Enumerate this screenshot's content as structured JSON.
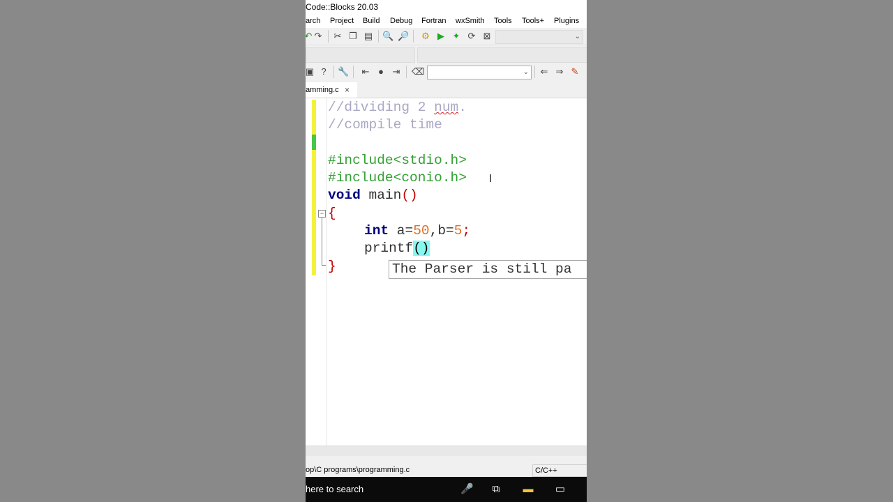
{
  "window": {
    "title": "Code::Blocks 20.03"
  },
  "menu": [
    "arch",
    "Project",
    "Build",
    "Debug",
    "Fortran",
    "wxSmith",
    "Tools",
    "Tools+",
    "Plugins"
  ],
  "tab": {
    "label": "amming.c",
    "close": "×"
  },
  "code": {
    "line1": "//dividing 2 ",
    "line1_word": "num",
    "line1_end": ".",
    "line2": "//compile time",
    "line4": "#include<stdio.h>",
    "line5": "#include<conio.h>",
    "line6_kw": "void",
    "line6_rest": " main",
    "line6_paren": "()",
    "line7": "{",
    "line8_kw": "int",
    "line8_a": " a=",
    "line8_n1": "50",
    "line8_b": ",b=",
    "line8_n2": "5",
    "line8_end": ";",
    "line9_fn": "printf",
    "line9_paren": "()",
    "line10": "}"
  },
  "tooltip": "The Parser is still pa",
  "status": {
    "path": "op\\C programs\\programming.c",
    "language": "C/C++"
  },
  "taskbar": {
    "search_placeholder": "here to search"
  }
}
